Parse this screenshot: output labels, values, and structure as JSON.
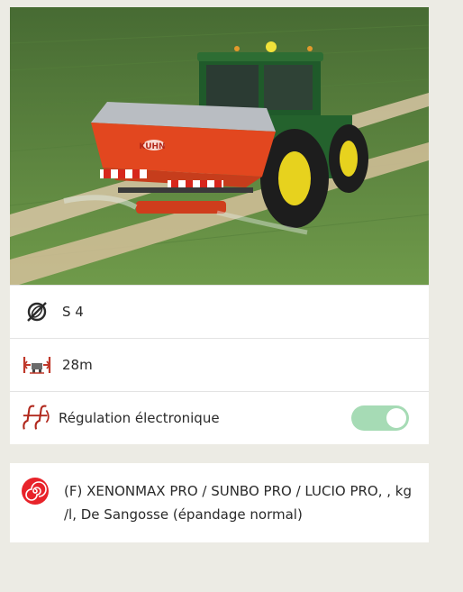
{
  "spreader": {
    "disc_label": "S 4",
    "width_label": "28m",
    "regulation_label": "Régulation électronique",
    "regulation_enabled": true,
    "brand_on_photo": "KUHN"
  },
  "fertilizer": {
    "label": "(F) XENONMAX PRO / SUNBO PRO / LUCIO PRO, , kg /l, De Sangosse (épandage normal)"
  },
  "icons": {
    "disc": "disc-slashed-icon",
    "width": "working-width-icon",
    "regulation": "regulation-ff-icon",
    "fertilizer": "fertilizer-swirl-icon"
  },
  "colors": {
    "background": "#ecebe4",
    "toggle_on": "#a6dbb5",
    "fertilizer_icon": "#e8232a",
    "icon_red": "#c0392b"
  }
}
